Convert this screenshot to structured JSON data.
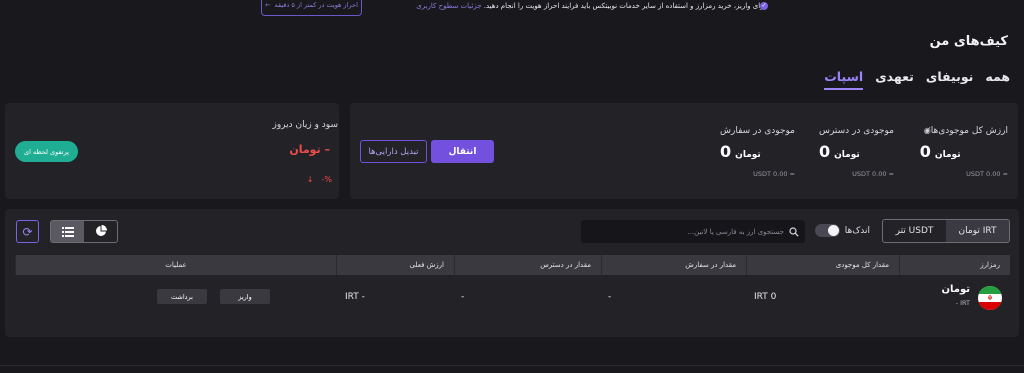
{
  "banner": {
    "text": "برای واریز، خرید رمزارز و استفاده از سایر خدمات نوبیتکس باید فرایند احراز هویت را انجام دهید.",
    "link": "جزئیات سطوح کاربری",
    "verify_button": "احراز هویت در کمتر از ۵ دقیقه"
  },
  "page": {
    "title": "کیف‌های من"
  },
  "tabs": [
    {
      "label": "اسپات",
      "active": true
    },
    {
      "label": "تعهدی",
      "active": false
    },
    {
      "label": "نوبیفای",
      "active": false
    },
    {
      "label": "همه",
      "active": false
    }
  ],
  "summary": {
    "total": {
      "label": "ارزش کل موجودی‌ها",
      "value": "0",
      "currency": "تومان",
      "usdt": "≈ USDT 0.00"
    },
    "available": {
      "label": "موجودی در دسترس",
      "value": "0",
      "currency": "تومان",
      "usdt": "≈ USDT 0.00"
    },
    "in_orders": {
      "label": "موجودی در سفارش",
      "value": "0",
      "currency": "تومان",
      "usdt": "≈ USDT 0.00"
    },
    "transfer_button": "انتقال",
    "convert_button": "تبدیل دارایی‌ها"
  },
  "profit": {
    "title": "سود و زیان دیروز",
    "value": "– تومان",
    "percent": "-%",
    "instant_button": "پرتفوی لحظه ای"
  },
  "controls": {
    "seg": [
      {
        "label": "تومان IRT",
        "active": true
      },
      {
        "label": "تتر USDT",
        "active": false
      }
    ],
    "small_toggle_label": "اندک‌ها",
    "search_placeholder": "جستجوی ارز به فارسی یا لاتین..."
  },
  "table": {
    "headers": [
      "رمزارز",
      "مقدار کل موجودی",
      "مقدار در سفارش",
      "مقدار در دسترس",
      "ارزش فعلی",
      "عملیات"
    ],
    "rows": [
      {
        "coin": "تومان",
        "coin_sub": "- IRT",
        "total": "IRT 0",
        "in_order": "-",
        "available": "-",
        "current_value": "IRT -",
        "deposit": "واریز",
        "withdraw": "برداشت"
      }
    ]
  }
}
